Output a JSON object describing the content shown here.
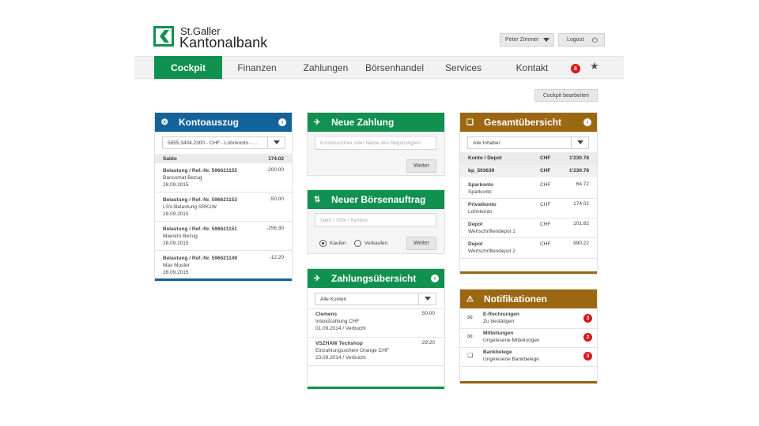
{
  "brand": {
    "line1": "St.Galler",
    "line2": "Kantonalbank"
  },
  "user": {
    "name": "Peter Zimmer",
    "logout": "Logout",
    "logout_icon": "power-icon"
  },
  "nav": {
    "items": [
      "Cockpit",
      "Finanzen",
      "Zahlungen",
      "Börsenhandel",
      "Services",
      "Kontakt"
    ],
    "active": "Cockpit",
    "badge": "8",
    "star_icon": "star-icon"
  },
  "cockpit_edit": "Cockpit bearbeiten",
  "kontoauszug": {
    "title": "Kontoauszug",
    "account_select": "5855.3404.2300 - CHF - Lohnkonto - ...",
    "saldo_label": "Saldo",
    "saldo_value": "174.02",
    "entries": [
      {
        "ref": "Belastung / Ref.-Nr. 596621155",
        "desc": "Bancomat Bezug",
        "date": "28.09.2015",
        "amount": "-200.00"
      },
      {
        "ref": "Belastung / Ref.-Nr. 596621153",
        "desc": "LSV-Belastung SRK1W",
        "date": "28.09.2015",
        "amount": "-50.00"
      },
      {
        "ref": "Belastung / Ref.-Nr. 596621151",
        "desc": "Maestro Bezug",
        "date": "28.09.2015",
        "amount": "-256.30"
      },
      {
        "ref": "Belastung / Ref.-Nr. 596621149",
        "desc": "Max Muster",
        "date": "28.09.2015",
        "amount": "-12.20"
      }
    ]
  },
  "neue_zahlung": {
    "title": "Neue Zahlung",
    "placeholder": "Kontonummer oder Name des Begünstigten",
    "button": "Weiter"
  },
  "boersenauftrag": {
    "title": "Neuer Börsenauftrag",
    "placeholder": "Valor / ISIN / Symbol",
    "buy": "Kaufen",
    "sell": "Verkaufen",
    "button": "Weiter"
  },
  "zahlungsuebersicht": {
    "title": "Zahlungsübersicht",
    "filter": "Alle Konten",
    "entries": [
      {
        "name": "Clemens",
        "type": "Inlandzahlung CHF",
        "date_status": "01.09.2014 / Verbucht",
        "amount": "50.00"
      },
      {
        "name": "VSZHAW Techshop",
        "type": "Einzahlungsschein Orange CHF",
        "date_status": "23.09.2014 / Verbucht",
        "amount": "29.20"
      }
    ]
  },
  "gesamtuebersicht": {
    "title": "Gesamtübersicht",
    "filter": "Alle Inhaber",
    "header": {
      "col1": "Konto / Depot",
      "col2": "CHF",
      "col3": "1'230.78"
    },
    "subheader": {
      "col1": "bp_503639",
      "col2": "CHF",
      "col3": "1'230.78"
    },
    "rows": [
      {
        "name": "Sparkonto",
        "sub": "Sparkonto",
        "cur": "CHF",
        "value": "64.72"
      },
      {
        "name": "Privatkonto",
        "sub": "Lohnkonto",
        "cur": "CHF",
        "value": "174.02"
      },
      {
        "name": "Depot",
        "sub": "Wertschriftendepot 1",
        "cur": "CHF",
        "value": "101.82"
      },
      {
        "name": "Depot",
        "sub": "Wertschriftendepot 2",
        "cur": "CHF",
        "value": "890.22"
      }
    ]
  },
  "notifikationen": {
    "title": "Notifikationen",
    "items": [
      {
        "title": "E-Rechnungen",
        "sub": "Zu bestätigen",
        "count": "3",
        "icon": "invoice-icon"
      },
      {
        "title": "Mitteilungen",
        "sub": "Ungelesene Mitteilungen",
        "count": "2",
        "icon": "envelope-icon"
      },
      {
        "title": "Bankbelege",
        "sub": "Ungelesene Bankbelege",
        "count": "3",
        "icon": "documents-icon"
      }
    ]
  },
  "colors": {
    "green": "#109150",
    "blue": "#13639b",
    "brown": "#9b6811",
    "badge_red": "#d8181b"
  }
}
